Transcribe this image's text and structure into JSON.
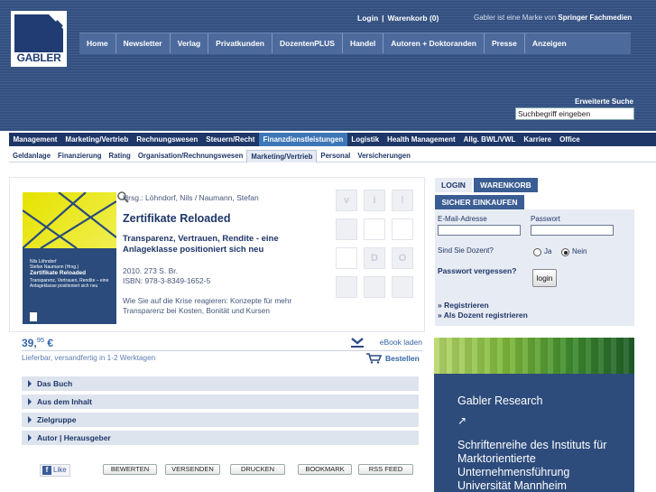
{
  "header": {
    "logo_text": "GABLER",
    "login": "Login",
    "cart": "Warenkorb (0)",
    "brand_prefix": "Gabler ist eine Marke von",
    "brand_name": "Springer Fachmedien",
    "search_label": "Erweiterte Suche",
    "search_value": "Suchbegriff eingeben"
  },
  "topnav": [
    "Home",
    "Newsletter",
    "Verlag",
    "Privatkunden",
    "DozentenPLUS",
    "Handel",
    "Autoren + Doktoranden",
    "Presse",
    "Anzeigen"
  ],
  "catnav": [
    "Management",
    "Marketing/Vertrieb",
    "Rechnungswesen",
    "Steuern/Recht",
    "Finanzdienstleistungen",
    "Logistik",
    "Health Management",
    "Allg. BWL/VWL",
    "Karriere",
    "Office"
  ],
  "catnav_active": 4,
  "subnav": [
    "Geldanlage",
    "Finanzierung",
    "Rating",
    "Organisation/Rechnungswesen",
    "Marketing/Vertrieb",
    "Personal",
    "Versicherungen"
  ],
  "subnav_active": 4,
  "product": {
    "editors": "Hrsg.: Löhndorf, Nils / Naumann, Stefan",
    "title": "Zertifikate Reloaded",
    "subtitle": "Transparenz, Vertrauen, Rendite - eine Anlageklasse positioniert sich neu",
    "year_pages": "2010. 273 S. Br.",
    "isbn": "ISBN: 978-3-8349-1652-5",
    "description": "Wie Sie auf die Krise reagieren: Konzepte für mehr Transparenz bei Kosten, Bonität und Kursen",
    "cover_authors": "Nils Löhndorf\nStefan Naumann (Hrsg.)",
    "cover_title": "Zertifikate Reloaded",
    "cover_subtitle": "Transparenz, Vertrauen, Rendite – eine Anlageklasse positioniert sich neu",
    "price_main": "39,",
    "price_cents": "95",
    "price_currency": " €",
    "ebook": "eBook laden",
    "delivery": "Lieferbar, versandfertig in 1-2 Werktagen",
    "order": "Bestellen"
  },
  "tools": [
    "v",
    "i",
    "!",
    "",
    "",
    "",
    "",
    "D",
    "O",
    "",
    "",
    ""
  ],
  "accordion": [
    "Das Buch",
    "Aus dem Inhalt",
    "Zielgruppe",
    "Autor | Herausgeber"
  ],
  "share": {
    "like": "Like",
    "buttons": [
      "BEWERTEN",
      "VERSENDEN",
      "DRUCKEN",
      "BOOKMARK",
      "RSS FEED"
    ]
  },
  "login": {
    "tab_login": "LOGIN",
    "tab_cart": "WARENKORB",
    "tab_secure": "SICHER EINKAUFEN",
    "email_label": "E-Mail-Adresse",
    "password_label": "Passwort",
    "lecturer_question": "Sind Sie Dozent?",
    "yes": "Ja",
    "no": "Nein",
    "forgot": "Passwort vergessen?",
    "button": "login",
    "register": "» Registrieren",
    "register_lecturer": "» Als Dozent registrieren"
  },
  "promo": {
    "title": "Gabler Research",
    "arrow": "↗",
    "body": "Schriftenreihe des Instituts für Marktorientierte Unternehmensführung Universität Mannheim"
  },
  "colors": {
    "header": "#33507f",
    "catnav": "#1e3668",
    "active": "#3d76b6",
    "panel": "#e7ebf3",
    "promo": "#2d4c7c"
  }
}
